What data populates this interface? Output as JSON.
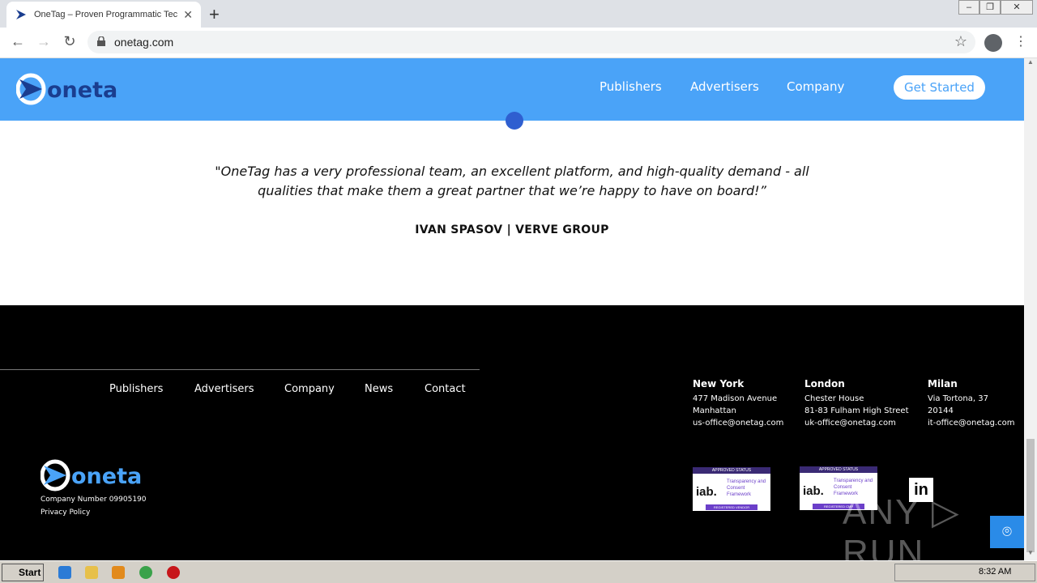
{
  "browser": {
    "tab_title": "OneTag – Proven Programmatic Tec",
    "tab_close": "✕",
    "new_tab": "+",
    "url": "onetag.com",
    "win_min": "–",
    "win_max": "❐",
    "win_close": "✕"
  },
  "header": {
    "logo": "onetag",
    "nav": [
      "Publishers",
      "Advertisers",
      "Company"
    ],
    "cta": "Get Started"
  },
  "testimonial": {
    "quote": "\"OneTag has a very professional team, an excellent platform, and high-quality demand - all qualities that make them a great partner that we’re happy to have on board!”",
    "author": "IVAN SPASOV | VERVE GROUP"
  },
  "footer": {
    "links": [
      "Publishers",
      "Advertisers",
      "Company",
      "News",
      "Contact"
    ],
    "offices": [
      {
        "city": "New York",
        "lines": [
          "477 Madison Avenue",
          "Manhattan",
          "us-office@onetag.com"
        ]
      },
      {
        "city": "London",
        "lines": [
          "Chester House",
          "81-83 Fulham High Street",
          "uk-office@onetag.com"
        ]
      },
      {
        "city": "Milan",
        "lines": [
          "Via Tortona, 37",
          "20144",
          "it-office@onetag.com"
        ]
      }
    ],
    "company_number": "Company Number 09905190",
    "privacy": "Privacy Policy",
    "badges": [
      {
        "top": "APPROVED STATUS",
        "iab": "iab.",
        "tcf": "Transparency and Consent Framework",
        "bottom": "REGISTERED VENDOR"
      },
      {
        "top": "APPROVED STATUS",
        "iab": "iab.",
        "tcf": "Transparency and Consent Framework",
        "bottom": "REGISTERED CMP"
      }
    ],
    "linkedin": "in",
    "watermark": "ANY ▷ RUN"
  },
  "taskbar": {
    "start": "Start",
    "clock": "8:32 AM"
  },
  "colors": {
    "header_blue": "#4aa3f8",
    "dot_blue": "#2f5fd0"
  }
}
